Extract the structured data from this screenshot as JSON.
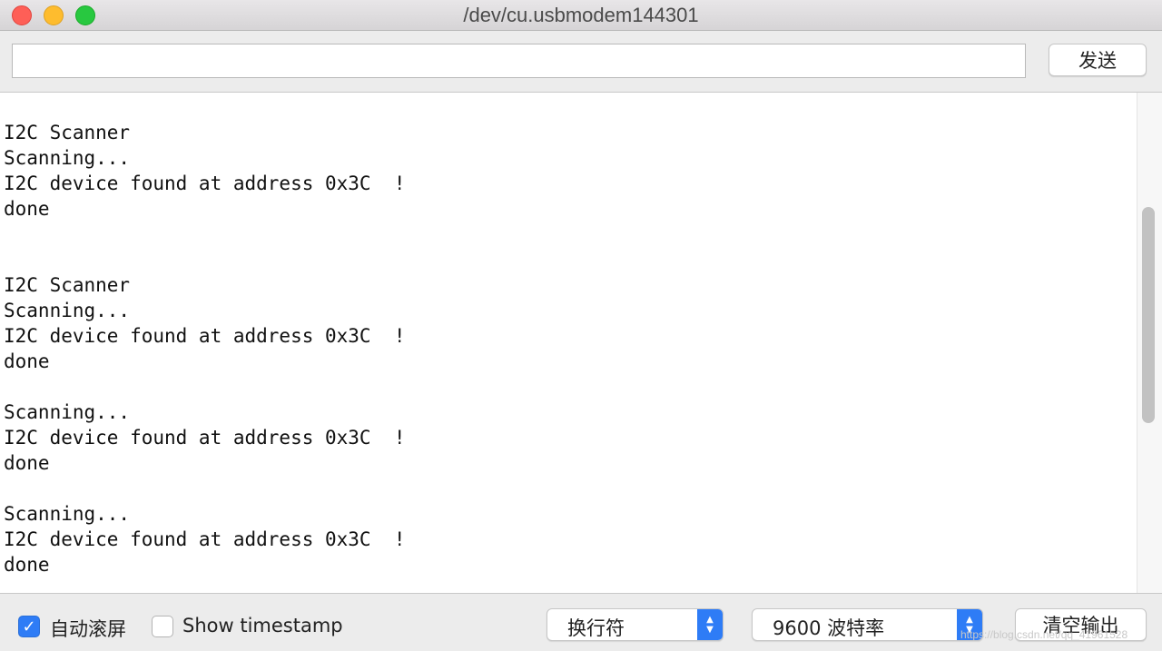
{
  "window": {
    "title": "/dev/cu.usbmodem144301"
  },
  "sendbar": {
    "input_value": "",
    "send_label": "发送"
  },
  "output": {
    "lines": [
      "I2C Scanner",
      "Scanning...",
      "I2C device found at address 0x3C  !",
      "done",
      "",
      "",
      "I2C Scanner",
      "Scanning...",
      "I2C device found at address 0x3C  !",
      "done",
      "",
      "Scanning...",
      "I2C device found at address 0x3C  !",
      "done",
      "",
      "Scanning...",
      "I2C device found at address 0x3C  !",
      "done"
    ]
  },
  "bottombar": {
    "autoscroll_label": "自动滚屏",
    "autoscroll_checked": true,
    "timestamp_label": "Show timestamp",
    "timestamp_checked": false,
    "line_ending_selected": "换行符",
    "baud_rate_selected": "9600 波特率",
    "clear_label": "清空输出",
    "watermark": "https://blog.csdn.net/qq_41961528"
  },
  "colors": {
    "accent": "#2e7cf6",
    "close": "#fe5f57",
    "minimize": "#febc2e",
    "maximize": "#28c840"
  }
}
